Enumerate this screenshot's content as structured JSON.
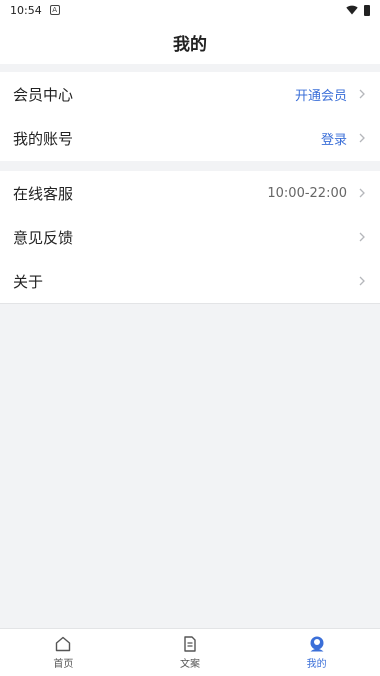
{
  "status_bar": {
    "time": "10:54",
    "notif_glyph": "A"
  },
  "header": {
    "title": "我的"
  },
  "group1": [
    {
      "label": "会员中心",
      "value": "开通会员",
      "value_color": "#3b6fd8"
    },
    {
      "label": "我的账号",
      "value": "登录",
      "value_color": "#3b6fd8"
    }
  ],
  "group2": [
    {
      "label": "在线客服",
      "value": "10:00-22:00"
    },
    {
      "label": "意见反馈",
      "value": ""
    },
    {
      "label": "关于",
      "value": ""
    }
  ],
  "tabs": [
    {
      "label": "首页",
      "icon": "home-icon",
      "active": false
    },
    {
      "label": "文案",
      "icon": "document-icon",
      "active": false
    },
    {
      "label": "我的",
      "icon": "profile-icon",
      "active": true
    }
  ],
  "colors": {
    "accent": "#3b6fd8",
    "background": "#f2f3f5"
  }
}
